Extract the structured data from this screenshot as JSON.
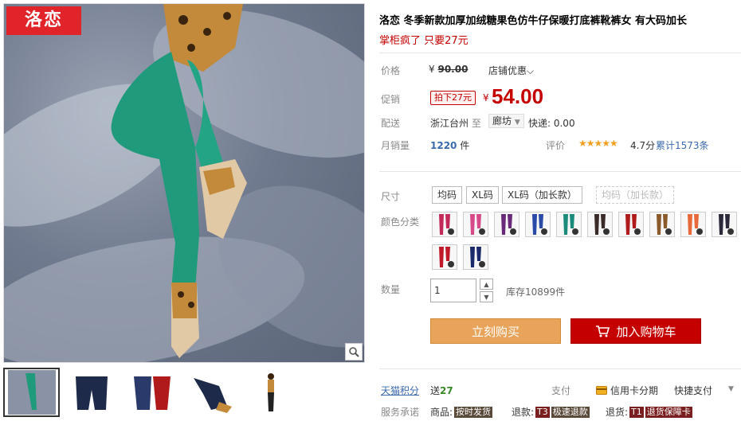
{
  "brand": {
    "logo_text": "洛恋",
    "color": "#e0242a"
  },
  "product": {
    "title": "洛恋 冬季新款加厚加绒糖果色仿牛仔保暖打底裤靴裤女 有大码加长",
    "subtitle": "掌柜疯了 只要27元"
  },
  "price": {
    "label": "价格",
    "currency": "¥",
    "original": "90.00",
    "shop_discount": "店铺优惠"
  },
  "promo": {
    "label": "促销",
    "tag": "拍下27元",
    "currency": "¥",
    "price": "54.00"
  },
  "delivery": {
    "label": "配送",
    "from": "浙江台州",
    "to_word": "至",
    "to": "廊坊",
    "express": "快递: 0.00"
  },
  "sales": {
    "label": "月销量",
    "count": "1220",
    "unit": "件",
    "rating_label": "评价",
    "stars": "★★★★★",
    "score": "4.7分",
    "reviews": "累计1573条"
  },
  "size": {
    "label": "尺寸",
    "options": [
      "均码",
      "XL码",
      "XL码（加长款）",
      "均码（加长款）"
    ]
  },
  "color": {
    "label": "颜色分类",
    "swatch_colors": [
      "#c22a5a",
      "#d64a8a",
      "#6a2a7a",
      "#2a4aa8",
      "#1a8a7a",
      "#3a2a2a",
      "#b01a1a",
      "#8a5a2a",
      "#e86a3a",
      "#2a2a3a",
      "#c01a2a",
      "#1a2a6a"
    ]
  },
  "quantity": {
    "label": "数量",
    "value": "1",
    "stock": "库存10899件"
  },
  "actions": {
    "buy_now": "立刻购买",
    "add_cart": "加入购物车"
  },
  "points": {
    "label": "天猫积分",
    "prefix": "送",
    "value": "27"
  },
  "payment": {
    "label": "支付",
    "credit": "信用卡分期",
    "quick": "快捷支付"
  },
  "promise": {
    "label": "服务承诺",
    "items": [
      {
        "prefix": "商品:",
        "tag": "按时发货"
      },
      {
        "prefix": "退款:",
        "tag": "极速退款",
        "badge": "T3"
      },
      {
        "prefix": "退货:",
        "tag": "退货保障卡",
        "badge": "T1"
      }
    ]
  },
  "colors": {
    "accent": "#c40000",
    "buy_now": "#e8a45a",
    "link": "#3a6aad"
  }
}
